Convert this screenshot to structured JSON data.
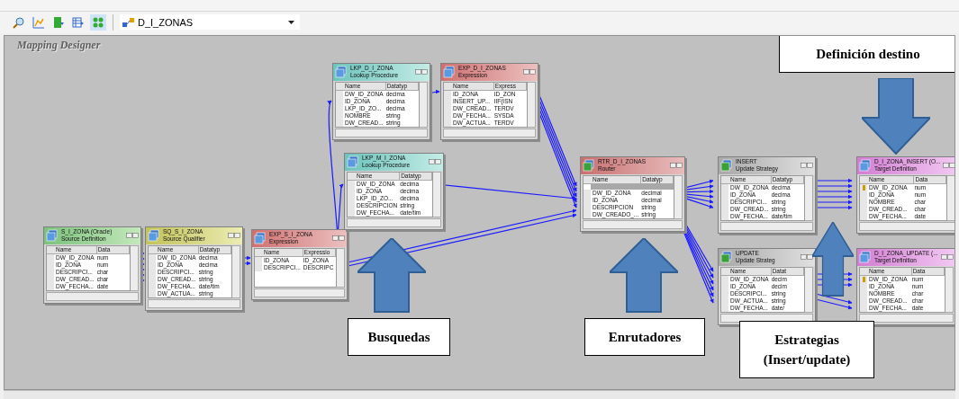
{
  "toolbar": {
    "mapping": "D_I_ZONAS"
  },
  "canvas": {
    "title": "Mapping Designer"
  },
  "transformations": [
    {
      "kind": "source",
      "title": "S_I_ZONA (Oracle)",
      "subtitle": "Source Definition",
      "columns": [
        "Name",
        "Data"
      ],
      "rows": [
        {
          "name": "DW_ID_ZONA",
          "type": "num"
        },
        {
          "name": "ID_ZONA",
          "type": "num"
        },
        {
          "name": "DESCRIPCI...",
          "type": "char"
        },
        {
          "name": "DW_CREAD...",
          "type": "char"
        },
        {
          "name": "DW_FECHA...",
          "type": "date"
        }
      ]
    },
    {
      "kind": "qualifier",
      "title": "SQ_S_I_ZONA",
      "subtitle": "Source Qualifier",
      "columns": [
        "Name",
        "Datatyp"
      ],
      "rows": [
        {
          "name": "DW_ID_ZONA",
          "type": "decima"
        },
        {
          "name": "ID_ZONA",
          "type": "decima"
        },
        {
          "name": "DESCRIPCI...",
          "type": "string"
        },
        {
          "name": "DW_CREAD...",
          "type": "string"
        },
        {
          "name": "DW_FECHA...",
          "type": "date/tim"
        },
        {
          "name": "DW_ACTUA...",
          "type": "string"
        }
      ]
    },
    {
      "kind": "expression",
      "title": "EXP_S_I_ZONA",
      "subtitle": "Expression",
      "columns": [
        "Name",
        "Expressio"
      ],
      "rows": [
        {
          "name": "ID_ZONA",
          "type": "ID_ZONA"
        },
        {
          "name": "DESCRIPCI...",
          "type": "DESCRIPC"
        }
      ]
    },
    {
      "kind": "lookup",
      "title": "LKP_D_I_ZONA",
      "subtitle": "Lookup Procedure",
      "columns": [
        "Name",
        "Datatyp"
      ],
      "rows": [
        {
          "name": "DW_ID_ZONA",
          "type": "decima"
        },
        {
          "name": "ID_ZONA",
          "type": "decima"
        },
        {
          "name": "LKP_ID_ZO...",
          "type": "decima"
        },
        {
          "name": "NOMBRE",
          "type": "string"
        },
        {
          "name": "DW_CREAD...",
          "type": "string"
        }
      ]
    },
    {
      "kind": "expression",
      "title": "EXP_D_I_ZONAS",
      "subtitle": "Expression",
      "columns": [
        "Name",
        "Express"
      ],
      "rows": [
        {
          "name": "ID_ZONA",
          "type": "ID_ZON"
        },
        {
          "name": "INSERT_UP...",
          "type": "IIF(ISN"
        },
        {
          "name": "DW_CREAD...",
          "type": "TERDV"
        },
        {
          "name": "DW_FECHA...",
          "type": "SYSDA"
        },
        {
          "name": "DW_ACTUA...",
          "type": "TERDV"
        }
      ]
    },
    {
      "kind": "lookup",
      "title": "LKP_M_I_ZONA",
      "subtitle": "Lookup Procedure",
      "columns": [
        "Name",
        "Datatyp"
      ],
      "rows": [
        {
          "name": "DW_ID_ZONA",
          "type": "decima"
        },
        {
          "name": "ID_ZONA",
          "type": "decima"
        },
        {
          "name": "LKP_ID_ZO...",
          "type": "decima"
        },
        {
          "name": "DESCRIPCION",
          "type": "string"
        },
        {
          "name": "DW_FECHA...",
          "type": "date/tim"
        }
      ]
    },
    {
      "kind": "router",
      "title": "RTR_D_I_ZONAS",
      "subtitle": "Router",
      "columns": [
        "Name",
        "Datatyp"
      ],
      "rows": [
        {
          "name": "DW_ID_ZONA",
          "type": "decimal"
        },
        {
          "name": "ID_ZONA",
          "type": "decimal"
        },
        {
          "name": "DESCRIPCION",
          "type": "string"
        },
        {
          "name": "DW_CREADO_...",
          "type": "string"
        }
      ]
    },
    {
      "kind": "update",
      "title": "INSERT",
      "subtitle": "Update Strategy",
      "columns": [
        "Name",
        "Datatyp"
      ],
      "rows": [
        {
          "name": "DW_ID_ZONA",
          "type": "decima"
        },
        {
          "name": "ID_ZONA",
          "type": "decima"
        },
        {
          "name": "DESCRIPCI...",
          "type": "string"
        },
        {
          "name": "DW_CREAD...",
          "type": "string"
        },
        {
          "name": "DW_FECHA...",
          "type": "date/tim"
        }
      ]
    },
    {
      "kind": "update",
      "title": "UPDATE",
      "subtitle": "Update Strateg",
      "columns": [
        "Name",
        "Datat"
      ],
      "rows": [
        {
          "name": "DW_ID_ZONA",
          "type": "decim"
        },
        {
          "name": "ID_ZONA",
          "type": "decim"
        },
        {
          "name": "DESCRIPCI...",
          "type": "string"
        },
        {
          "name": "DW_ACTUA...",
          "type": "string"
        },
        {
          "name": "DW_FECHA...",
          "type": "date/"
        }
      ]
    },
    {
      "kind": "target",
      "title": "D_I_ZONA_INSERT (O...",
      "subtitle": "Target Definition",
      "columns": [
        "Name",
        "Data"
      ],
      "rows": [
        {
          "name": "DW_ID_ZONA",
          "type": "num",
          "key": true
        },
        {
          "name": "ID_ZONA",
          "type": "num",
          "key": false
        },
        {
          "name": "NOMBRE",
          "type": "char",
          "key": false
        },
        {
          "name": "DW_CREAD...",
          "type": "char",
          "key": false
        },
        {
          "name": "DW_FECHA...",
          "type": "date",
          "key": false
        }
      ]
    },
    {
      "kind": "target",
      "title": "D_I_ZONA_UPDATE (...",
      "subtitle": "Target Definition",
      "columns": [
        "Name",
        "Data"
      ],
      "rows": [
        {
          "name": "DW_ID_ZONA",
          "type": "num",
          "key": true
        },
        {
          "name": "ID_ZONA",
          "type": "num",
          "key": false
        },
        {
          "name": "NOMBRE",
          "type": "char",
          "key": false
        },
        {
          "name": "DW_CREAD...",
          "type": "char",
          "key": false
        },
        {
          "name": "DW_FECHA...",
          "type": "date",
          "key": false
        }
      ]
    }
  ],
  "callouts": [
    {
      "text": "Definición destino"
    },
    {
      "text": "Busquedas"
    },
    {
      "text": "Enrutadores"
    },
    {
      "text": "Estrategias (Insert/update)"
    }
  ]
}
